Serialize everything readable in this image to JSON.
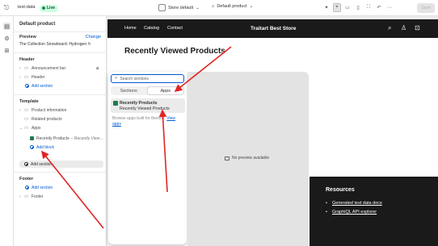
{
  "topbar": {
    "store_name": "test-data",
    "live_label": "Live",
    "theme": "Store default",
    "page": "Default product",
    "save_label": "Save"
  },
  "sidebar": {
    "title": "Default product",
    "preview": {
      "heading": "Preview",
      "change_label": "Change",
      "value": "The Collection Snowboard: Hydrogen"
    },
    "header": {
      "heading": "Header",
      "items": [
        "Announcement bar",
        "Header"
      ],
      "add_label": "Add section"
    },
    "template": {
      "heading": "Template",
      "items": [
        "Product information",
        "Related products",
        "Apps"
      ],
      "app_block": "Recently Products",
      "app_block_sub": "– Recently View…",
      "add_block": "Add block",
      "add_section": "Add section"
    },
    "footer": {
      "heading": "Footer",
      "add_label": "Add section",
      "items": [
        "Footer"
      ]
    }
  },
  "popover": {
    "search_placeholder": "Search sections",
    "tabs": [
      "Sections",
      "Apps"
    ],
    "active_tab": "Apps",
    "app": {
      "name": "Recently Products",
      "block": "Recently Viewed Products"
    },
    "browse_text": "Browse apps built for themes.",
    "browse_link": "View apps",
    "no_preview": "No preview available"
  },
  "storefront": {
    "nav": [
      "Home",
      "Catalog",
      "Contact"
    ],
    "brand": "Traitart Best Store",
    "heading": "Recently Viewed Products",
    "footer": {
      "title": "Resources",
      "links": [
        "Generated test data docs",
        "GraphiQL API explorer"
      ]
    }
  },
  "colors": {
    "accent": "#005bd3",
    "live_bg": "#cdfee1",
    "store_dark": "#1a1a1a",
    "arrow": "#e02424"
  }
}
